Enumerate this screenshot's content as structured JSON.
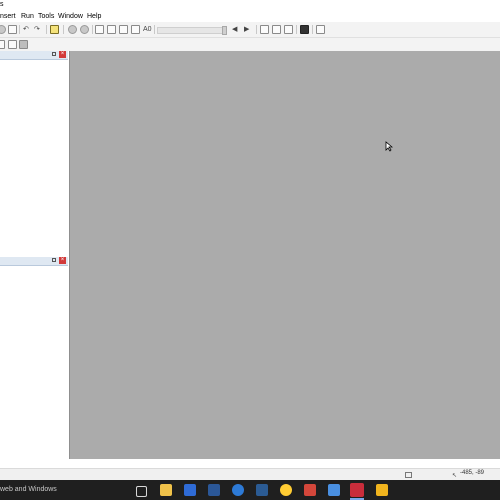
{
  "window": {
    "title": "s"
  },
  "menubar": {
    "items": [
      {
        "id": "insert",
        "label": "nsert"
      },
      {
        "id": "run",
        "label": "Run"
      },
      {
        "id": "tools",
        "label": "Tools"
      },
      {
        "id": "window",
        "label": "Window"
      },
      {
        "id": "help",
        "label": "Help"
      }
    ]
  },
  "toolbar": {
    "subscript_label": "A0"
  },
  "panels": {
    "top": {
      "pin_icon": "pin-icon",
      "close_icon": "close-icon"
    },
    "bottom": {
      "pin_icon": "pin-icon",
      "close_icon": "close-icon"
    }
  },
  "statusbar": {
    "coords": "-485, -89"
  },
  "taskbar": {
    "search_text": "web and Windows",
    "apps": [
      {
        "name": "task-view-icon",
        "color": "#d7d7d7"
      },
      {
        "name": "file-explorer-icon",
        "color": "#f0c24a"
      },
      {
        "name": "outlook-icon",
        "color": "#2f6bd6"
      },
      {
        "name": "word-icon",
        "color": "#2b5797"
      },
      {
        "name": "onedrive-icon",
        "color": "#2d7ad6"
      },
      {
        "name": "photoshop-icon",
        "color": "#2b5b93"
      },
      {
        "name": "chrome-icon",
        "color": "#ffcc33"
      },
      {
        "name": "acrobat-icon",
        "color": "#d4473b"
      },
      {
        "name": "photos-icon",
        "color": "#4a90e2"
      },
      {
        "name": "ruby-app-icon",
        "color": "#c92d3b"
      },
      {
        "name": "python-icon",
        "color": "#f0b41e"
      }
    ]
  }
}
